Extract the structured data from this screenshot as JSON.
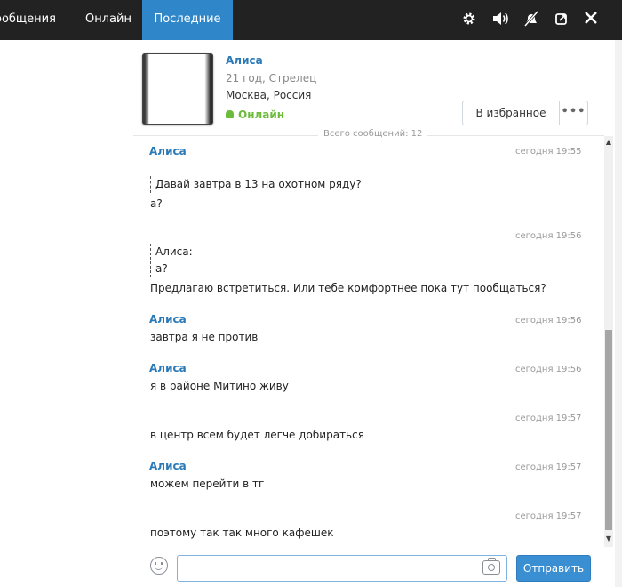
{
  "topbar": {
    "tabs": [
      {
        "label": "ообщения"
      },
      {
        "label": "Онлайн"
      },
      {
        "label": "Последние",
        "active": true
      }
    ],
    "icons": [
      "gear-icon",
      "speaker-icon",
      "mute-icon",
      "restore-icon",
      "close-icon"
    ]
  },
  "profile": {
    "name": "Алиса",
    "age": "21 год, Стрелец",
    "city": "Москва, Россия",
    "status": "Онлайн",
    "fav_label": "В избранное",
    "more_label": "•••"
  },
  "total_messages": "Всего сообщений: 12",
  "messages": [
    {
      "author": "Алиса",
      "time": "сегодня 19:55",
      "quote": [
        "Давай завтра в 13 на охотном ряду?"
      ],
      "text": "а?"
    },
    {
      "author": "",
      "time": "сегодня 19:56",
      "quote": [
        "Алиса:",
        "а?"
      ],
      "text": "Предлагаю встретиться. Или тебе комфортнее пока  тут пообщаться?"
    },
    {
      "author": "Алиса",
      "time": "сегодня 19:56",
      "text": "завтра я не против"
    },
    {
      "author": "Алиса",
      "time": "сегодня 19:56",
      "text": "я в районе Митино живу"
    },
    {
      "author": "",
      "time": "сегодня 19:57",
      "text": "в центр всем будет легче добираться"
    },
    {
      "author": "Алиса",
      "time": "сегодня 19:57",
      "text": "можем перейти в тг"
    },
    {
      "author": "",
      "time": "сегодня 19:57",
      "text": "поэтому так так много кафешек"
    }
  ],
  "composer": {
    "placeholder": "",
    "send_label": "Отправить"
  },
  "colors": {
    "topbar": "#222222",
    "active_tab": "#2f87c9",
    "author": "#2a7ab8",
    "online": "#6dbb3a",
    "send": "#3a8ed2"
  }
}
